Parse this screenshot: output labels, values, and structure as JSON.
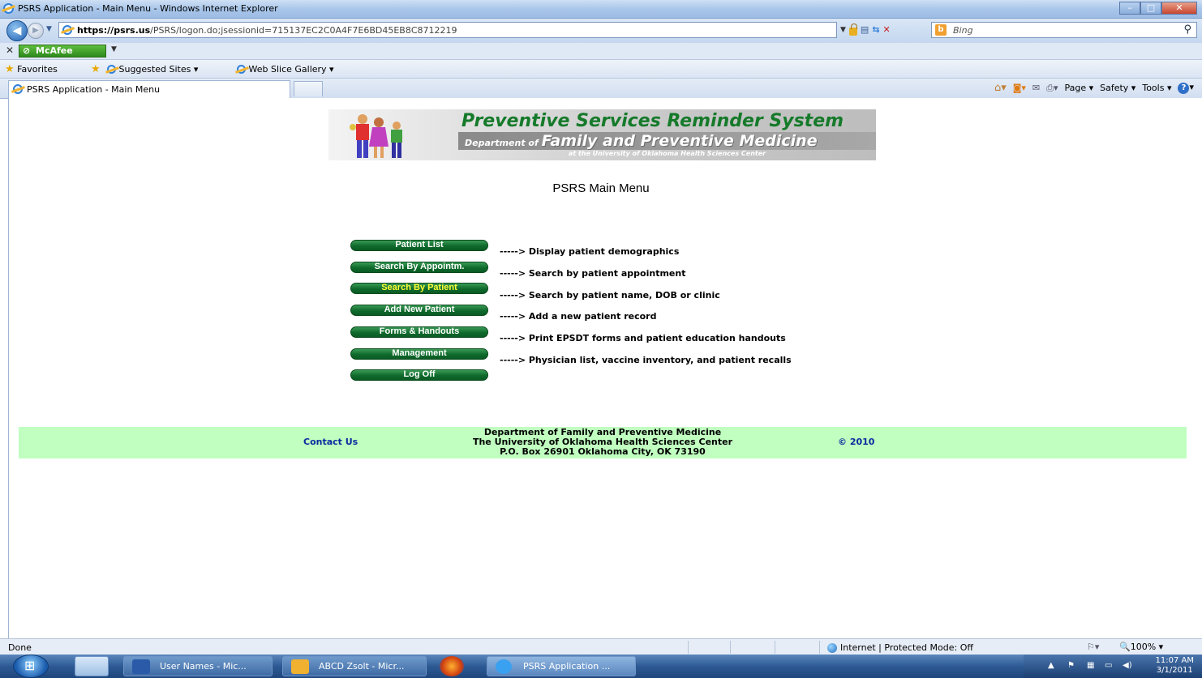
{
  "window": {
    "title": "PSRS Application - Main Menu - Windows Internet Explorer",
    "url_host": "https://psrs.us",
    "url_path": "/PSRS/logon.do;jsessionid=715137EC2C0A4F7E6BD45EB8C8712219",
    "search_placeholder": "Bing"
  },
  "toolbar": {
    "mcafee_label": "McAfee",
    "favorites_label": "Favorites",
    "suggested_sites": "Suggested Sites ▾",
    "web_slice": "Web Slice Gallery ▾",
    "tab_title": "PSRS Application - Main Menu",
    "cmd_page": "Page ▾",
    "cmd_safety": "Safety ▾",
    "cmd_tools": "Tools ▾"
  },
  "page": {
    "banner_title": "Preventive Services Reminder System",
    "banner_dept_prefix": "Department of",
    "banner_dept_name": "Family and Preventive Medicine",
    "banner_sub": "at the University of Oklahoma Health Sciences Center",
    "menu_title": "PSRS Main Menu",
    "menu_items": [
      {
        "label": "Patient List",
        "desc": "-----> Display patient demographics"
      },
      {
        "label": "Search By Appointm.",
        "desc": "-----> Search by patient appointment"
      },
      {
        "label": "Search By Patient",
        "desc": "-----> Search by patient name, DOB or clinic"
      },
      {
        "label": "Add New Patient",
        "desc": "-----> Add a new patient record"
      },
      {
        "label": "Forms & Handouts",
        "desc": "-----> Print EPSDT forms and patient education handouts"
      },
      {
        "label": "Management",
        "desc": "-----> Physician list, vaccine inventory, and patient recalls"
      },
      {
        "label": "Log Off",
        "desc": ""
      }
    ]
  },
  "footer": {
    "contact": "Contact Us",
    "line1": "Department of Family and Preventive Medicine",
    "line2": "The University of Oklahoma Health Sciences Center",
    "line3": "P.O. Box 26901 Oklahoma City, OK 73190",
    "copyright": "© 2010"
  },
  "status": {
    "left": "Done",
    "zone": "Internet | Protected Mode: Off",
    "zoom": "100%"
  },
  "taskbar": {
    "tasks": [
      "User Names - Mic...",
      "ABCD Zsolt - Micr...",
      "PSRS Application ..."
    ],
    "time": "11:07 AM",
    "date": "3/1/2011"
  },
  "colors": {
    "button_green": "#0f6a2c",
    "highlight_text": "#ffff33",
    "footer_bg": "#c0ffc0",
    "link_blue": "#0a2aa0",
    "banner_green": "#157a2a"
  }
}
